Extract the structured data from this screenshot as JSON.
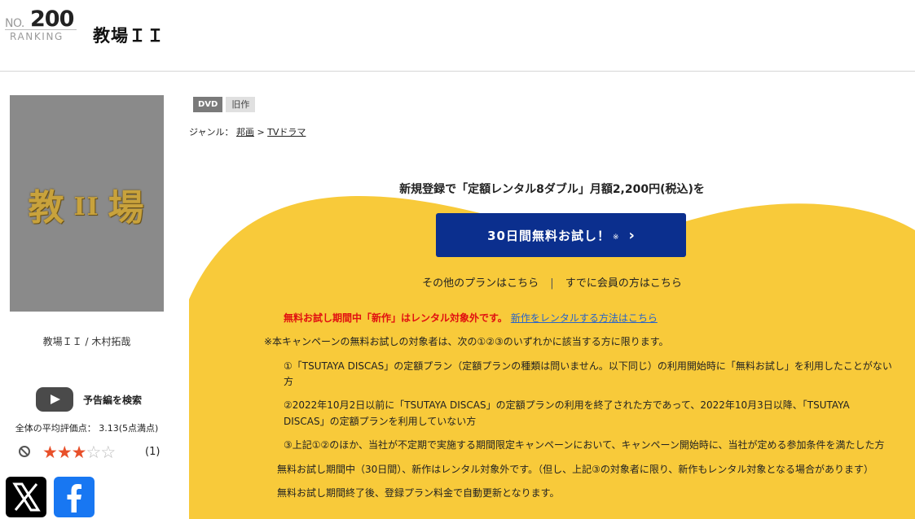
{
  "header": {
    "rank_prefix": "NO.",
    "rank_number": "200",
    "rank_label": "RANKING",
    "title": "教場ＩＩ"
  },
  "poster": {
    "title_left": "教",
    "title_roman": "II",
    "title_right": "場"
  },
  "work": {
    "caption": "教場ＩＩ / 木村拓哉"
  },
  "trailer": {
    "label": "予告編を検索"
  },
  "rating": {
    "average_text": "全体の平均評価点： 3.13(5点満点)",
    "stars_filled": 3,
    "stars_total": 5,
    "review_count": "(1)"
  },
  "badges": {
    "format": "DVD",
    "category": "旧作"
  },
  "genre": {
    "label": "ジャンル：",
    "level1": "邦画",
    "separator": ">",
    "level2": "TVドラマ"
  },
  "campaign": {
    "headline": "新規登録で「定額レンタル8ダブル」月額2,200円(税込)を",
    "cta_label": "30日間無料お試し！",
    "cta_note": "※",
    "cta_chevron": "›",
    "other_plans": "その他のプランはこちら",
    "plan_sep": "|",
    "members": "すでに会員の方はこちら",
    "notice_red": "無料お試し期間中「新作」はレンタル対象外です。",
    "notice_link": "新作をレンタルする方法はこちら",
    "lines": [
      "※本キャンペーンの無料お試しの対象者は、次の①②③のいずれかに該当する方に限ります。",
      "①「TSUTAYA DISCAS」の定額プラン（定額プランの種類は問いません。以下同じ）の利用開始時に「無料お試し」を利用したことがない",
      "方",
      "②2022年10月2日以前に「TSUTAYA DISCAS」の定額プランの利用を終了された方であって、2022年10月3日以降、「TSUTAYA",
      "DISCAS」の定額プランを利用していない方",
      "③上記①②のほか、当社が不定期で実施する期間限定キャンペーンにおいて、キャンペーン開始時に、当社が定める参加条件を満たした方",
      "無料お試し期間中（30日間）、新作はレンタル対象外です。（但し、上記③の対象者に限り、新作もレンタル対象となる場合があります）",
      "無料お試し期間終了後、登録プラン料金で自動更新となります。"
    ]
  },
  "colors": {
    "accent_yellow": "#f8ca3a",
    "cta_blue": "#0b2f8e",
    "notice_red": "#e11010",
    "link_blue": "#2a64c8",
    "star_orange": "#e8502a"
  }
}
